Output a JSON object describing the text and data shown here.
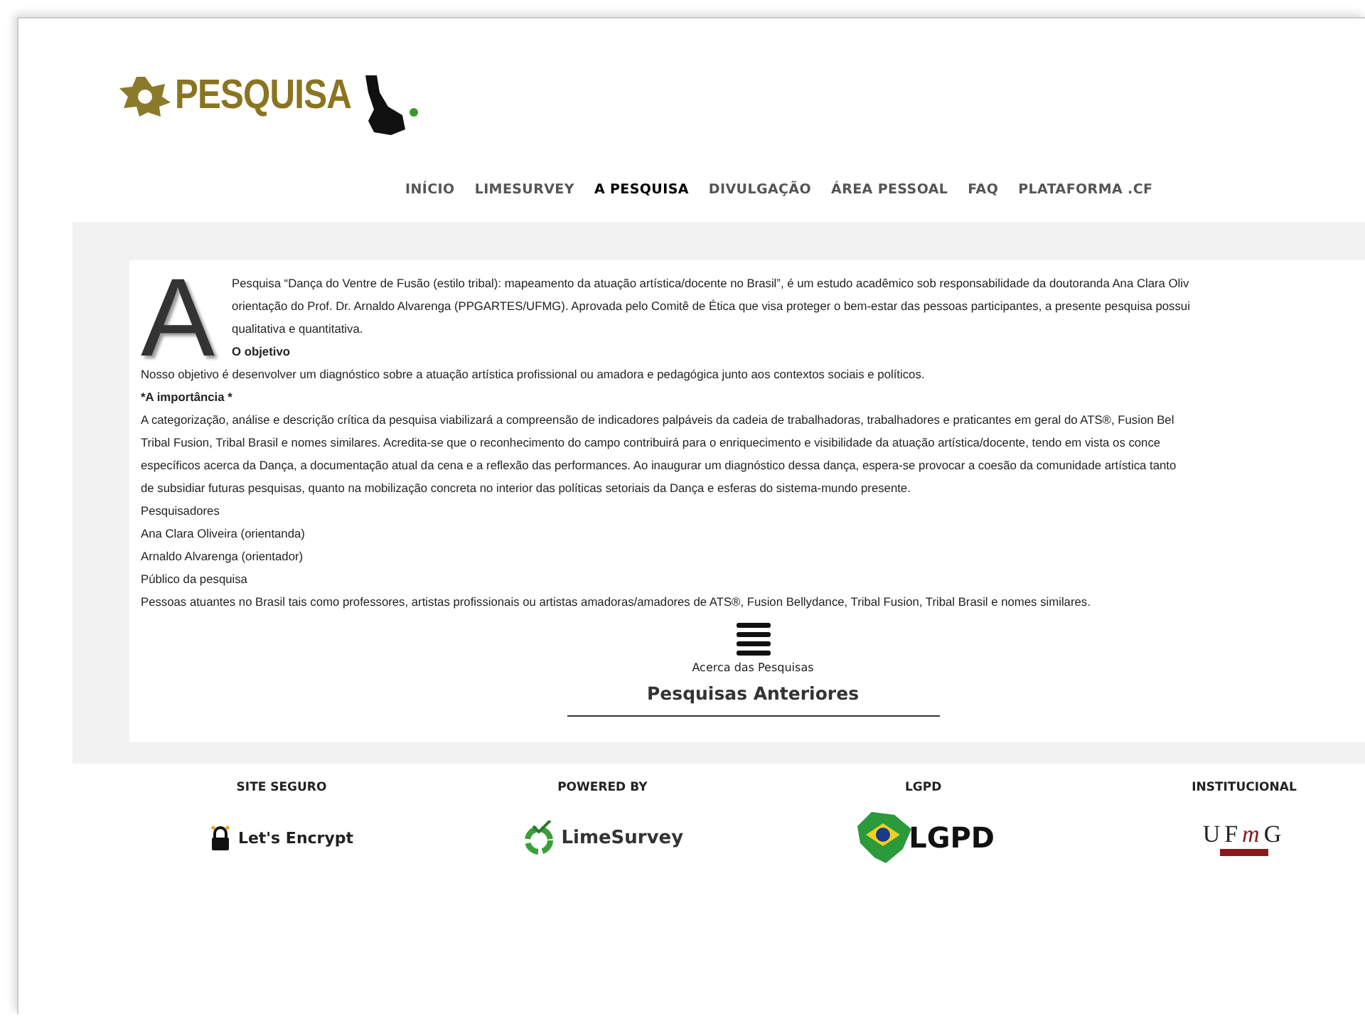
{
  "logo": {
    "text": "PESQUISA"
  },
  "nav": [
    {
      "label": "INÍCIO",
      "selected": false
    },
    {
      "label": "LIMESURVEY",
      "selected": false
    },
    {
      "label": "A PESQUISA",
      "selected": true
    },
    {
      "label": "DIVULGAÇÃO",
      "selected": false
    },
    {
      "label": "ÁREA PESSOAL",
      "selected": false
    },
    {
      "label": "FAQ",
      "selected": false
    },
    {
      "label": "PLATAFORMA .CF",
      "selected": false
    }
  ],
  "article": {
    "drop_cap": "A",
    "intro_lines": [
      "Pesquisa “Dança do Ventre de Fusão (estilo tribal): mapeamento da atuação artística/docente no Brasil”, é um estudo acadêmico sob responsabilidade da doutoranda Ana Clara Oliv",
      "orientação do Prof. Dr. Arnaldo Alvarenga (PPGARTES/UFMG). Aprovada pelo Comitê de Ética que visa proteger o bem-estar das pessoas participantes, a presente pesquisa possui",
      "qualitativa e quantitativa."
    ],
    "objective_heading": "O objetivo",
    "lines": [
      {
        "kind": "text",
        "text": "Nosso objetivo é desenvolver um diagnóstico sobre a atuação artística profissional ou amadora e pedagógica junto aos contextos sociais e políticos."
      },
      {
        "kind": "heading",
        "text": "*A importância *"
      },
      {
        "kind": "text",
        "text": "A categorização, análise e descrição crítica da pesquisa viabilizará a compreensão de indicadores palpáveis da cadeia de trabalhadoras, trabalhadores e praticantes em geral do ATS®, Fusion Bel"
      },
      {
        "kind": "text",
        "text": "Tribal Fusion, Tribal Brasil e nomes similares. Acredita-se que o reconhecimento do campo contribuirá para o enriquecimento e visibilidade da atuação artística/docente, tendo em vista os conce"
      },
      {
        "kind": "text",
        "text": "específicos acerca da Dança, a documentação atual da cena e a reflexão das performances. Ao inaugurar um diagnóstico dessa dança, espera-se provocar a coesão da comunidade artística tanto"
      },
      {
        "kind": "text",
        "text": "de subsidiar futuras pesquisas, quanto na mobilização concreta no interior das políticas setoriais da Dança e esferas do sistema-mundo presente."
      },
      {
        "kind": "text",
        "text": "Pesquisadores"
      },
      {
        "kind": "text",
        "text": "Ana Clara Oliveira (orientanda)"
      },
      {
        "kind": "text",
        "text": "Arnaldo Alvarenga (orientador)"
      },
      {
        "kind": "text",
        "text": "Público da pesquisa"
      },
      {
        "kind": "text",
        "text": "Pessoas atuantes no Brasil tais como professores, artistas profissionais ou artistas amadoras/amadores de ATS®, Fusion Bellydance, Tribal Fusion, Tribal Brasil e nomes similares."
      }
    ],
    "menu_label": "Acerca das Pesquisas",
    "section_title": "Pesquisas Anteriores"
  },
  "footer": [
    {
      "kind": "letsencrypt",
      "heading": "SITE SEGURO",
      "logo_text": "Let's Encrypt"
    },
    {
      "kind": "limesurvey",
      "heading": "POWERED BY",
      "logo_text": "LimeSurvey"
    },
    {
      "kind": "lgpd",
      "heading": "LGPD",
      "logo_text": "LGPD"
    },
    {
      "kind": "ufmg",
      "heading": "INSTITUCIONAL",
      "logo_parts": [
        {
          "text": "UF",
          "accent": false
        },
        {
          "text": "m",
          "accent": true
        },
        {
          "text": "G",
          "accent": false
        }
      ]
    }
  ]
}
